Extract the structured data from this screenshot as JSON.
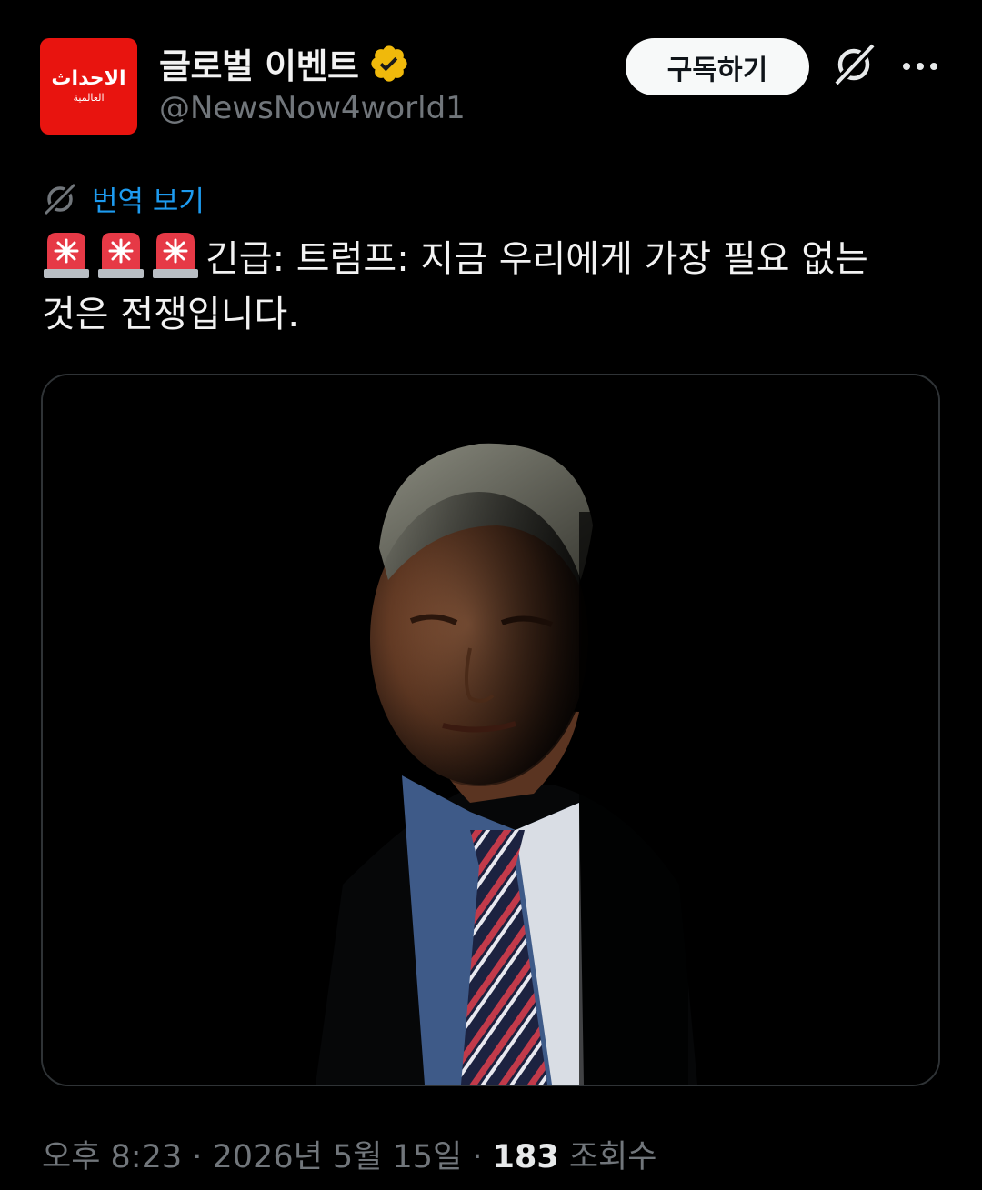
{
  "author": {
    "display_name": "글로벌 이벤트",
    "handle": "@NewsNow4world1",
    "avatar_text_1": "الاحداث",
    "avatar_text_2": "العالمية",
    "verified": true,
    "verified_badge_color": "#f0b90b"
  },
  "actions": {
    "subscribe_label": "구독하기",
    "grok_icon": "grok-icon",
    "more_icon": "more-icon"
  },
  "translate": {
    "label": "번역 보기",
    "icon": "grok-icon"
  },
  "tweet": {
    "emoji": "🚨🚨🚨",
    "text_line1": "긴급: 트럼프: 지금 우리에게 가장 필요 없는",
    "text_line2": "것은 전쟁입니다.",
    "media_alt": "dimly lit portrait of a man in a suit and striped tie"
  },
  "meta": {
    "time": "오후 8:23",
    "separator": " · ",
    "date": "2026년 5월 15일",
    "views_count": "183",
    "views_label": "조회수"
  },
  "colors": {
    "background": "#000000",
    "link": "#1d9bf0",
    "muted": "#71767b",
    "avatar_bg": "#e8140f"
  }
}
